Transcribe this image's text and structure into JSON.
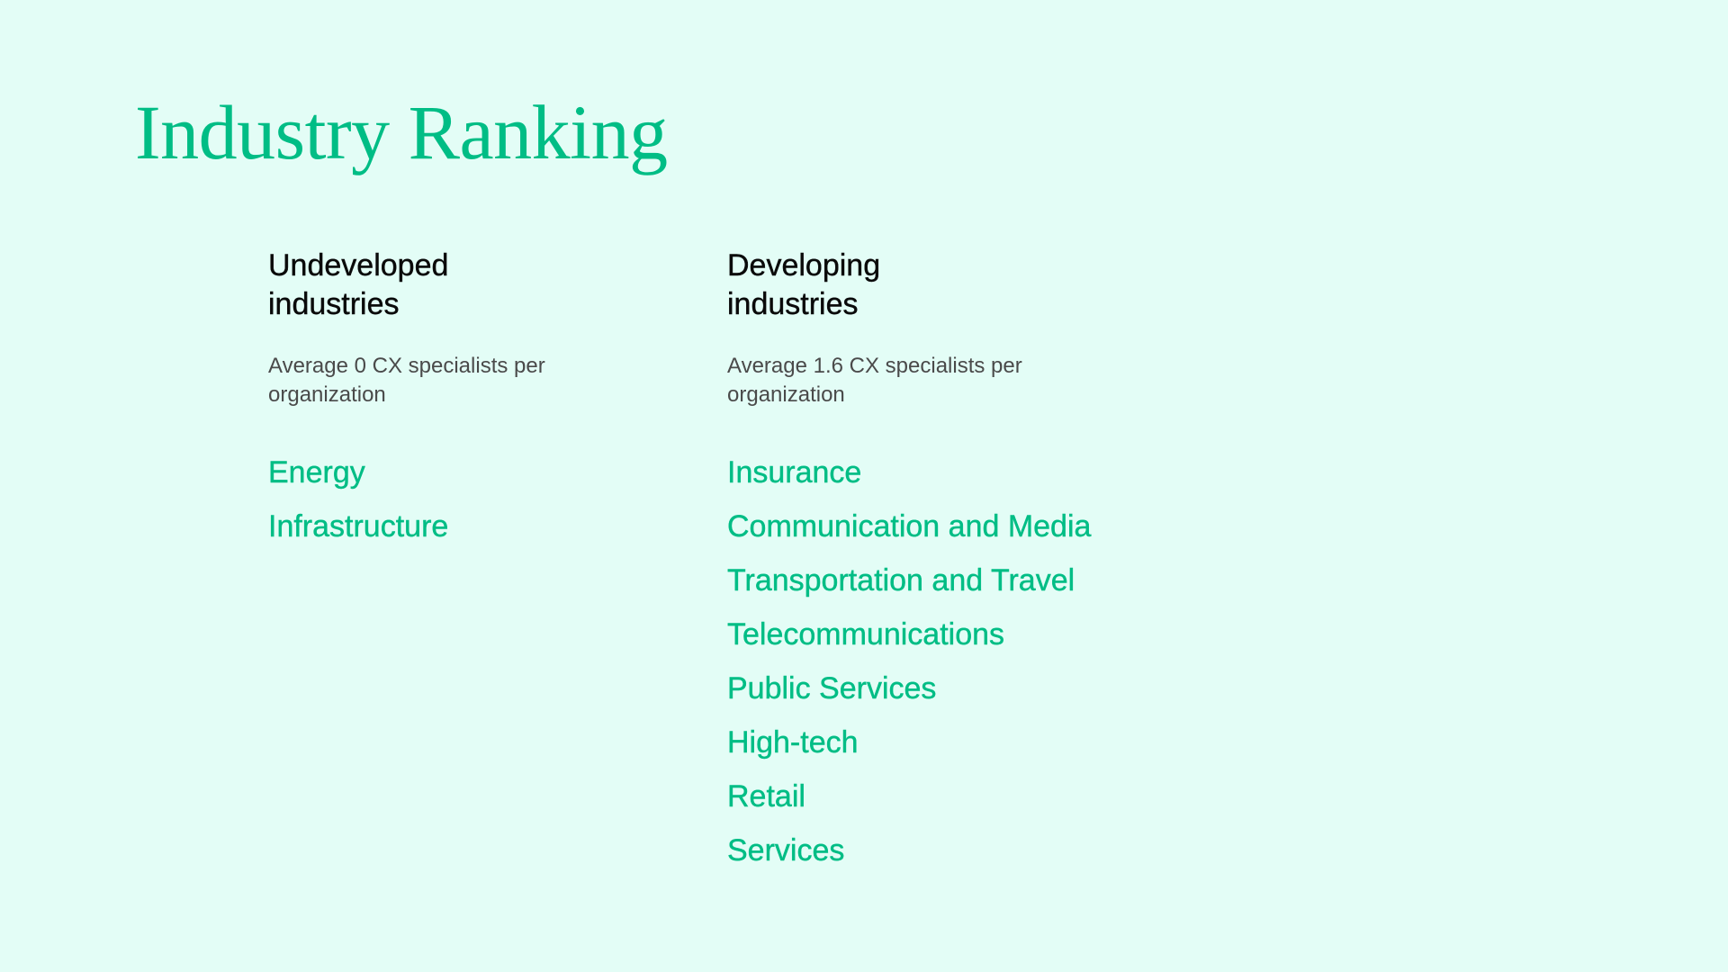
{
  "page": {
    "title": "Industry Ranking",
    "colors": {
      "background": "#e3fdf6",
      "accent": "#00bd85",
      "heading": "#0a0a0a",
      "muted": "#4a4a4a"
    }
  },
  "columns": [
    {
      "heading_line1": "Undeveloped",
      "heading_line2": "industries",
      "average": "Average 0 CX specialists per organization",
      "industries": [
        "Energy",
        "Infrastructure"
      ]
    },
    {
      "heading_line1": "Developing",
      "heading_line2": "industries",
      "average": "Average 1.6 CX specialists per organization",
      "industries": [
        "Insurance",
        "Communication and Media",
        "Transportation and Travel",
        "Telecommunications",
        "Public Services",
        "High-tech",
        "Retail",
        "Services"
      ]
    }
  ]
}
